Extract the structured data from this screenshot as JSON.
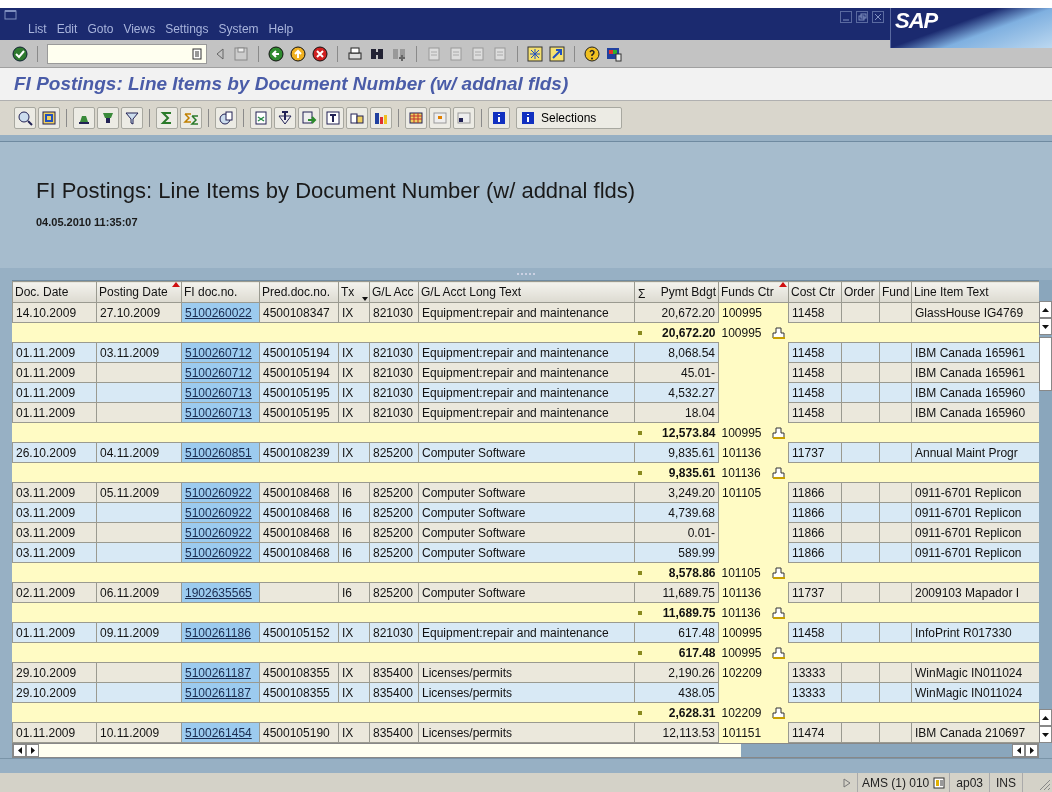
{
  "menu_bar": {
    "items": [
      "List",
      "Edit",
      "Goto",
      "Views",
      "Settings",
      "System",
      "Help"
    ]
  },
  "logo": "SAP",
  "screen_title": "FI Postings: Line Items by Document Number (w/ addnal flds)",
  "app_toolbar": {
    "selections_button": "Selections"
  },
  "report_header": {
    "title": "FI Postings: Line Items by Document Number (w/ addnal flds)",
    "timestamp": "04.05.2010 11:35:07"
  },
  "table": {
    "columns": [
      {
        "label": "Doc. Date",
        "sorted": false,
        "filtered": false
      },
      {
        "label": "Posting Date",
        "sorted": true,
        "filtered": false
      },
      {
        "label": "FI doc.no.",
        "sorted": false,
        "filtered": false
      },
      {
        "label": "Pred.doc.no.",
        "sorted": false,
        "filtered": false
      },
      {
        "label": "Tx",
        "sorted": false,
        "filtered": true
      },
      {
        "label": "G/L Acc",
        "sorted": false,
        "filtered": false
      },
      {
        "label": "G/L Acct Long Text",
        "sorted": false,
        "filtered": false
      },
      {
        "label": "Pymt Bdgt",
        "sum_sign": "Σ",
        "sorted": false,
        "filtered": false
      },
      {
        "label": "Funds Ctr",
        "sorted": true,
        "filtered": false
      },
      {
        "label": "Cost Ctr",
        "sorted": false,
        "filtered": false
      },
      {
        "label": "Order",
        "sorted": false,
        "filtered": false
      },
      {
        "label": "Fund",
        "sorted": false,
        "filtered": false
      },
      {
        "label": "Line Item Text",
        "sorted": false,
        "filtered": false
      }
    ],
    "rows": [
      {
        "kind": "item",
        "doc_date": "14.10.2009",
        "posting_date": "27.10.2009",
        "fi_doc": "5100260022",
        "pred_doc": "4500108347",
        "tx": "IX",
        "gl_acc": "821030",
        "gl_text": "Equipment:repair and maintenance",
        "pymt_bdgt": "20,672.20",
        "funds_ctr": "100995",
        "cost_ctr": "11458",
        "line_item_text": "GlassHouse IG4769"
      },
      {
        "kind": "subtotal",
        "amount": "20,672.20",
        "funds_ctr": "100995"
      },
      {
        "kind": "item",
        "doc_date": "01.11.2009",
        "posting_date": "03.11.2009",
        "fi_doc": "5100260712",
        "pred_doc": "4500105194",
        "tx": "IX",
        "gl_acc": "821030",
        "gl_text": "Equipment:repair and maintenance",
        "pymt_bdgt": "8,068.54",
        "cost_ctr": "11458",
        "line_item_text": "IBM Canada 165961"
      },
      {
        "kind": "item",
        "doc_date": "01.11.2009",
        "fi_doc": "5100260712",
        "pred_doc": "4500105194",
        "tx": "IX",
        "gl_acc": "821030",
        "gl_text": "Equipment:repair and maintenance",
        "pymt_bdgt": "45.01-",
        "cost_ctr": "11458",
        "line_item_text": "IBM Canada 165961"
      },
      {
        "kind": "item",
        "doc_date": "01.11.2009",
        "fi_doc": "5100260713",
        "pred_doc": "4500105195",
        "tx": "IX",
        "gl_acc": "821030",
        "gl_text": "Equipment:repair and maintenance",
        "pymt_bdgt": "4,532.27",
        "cost_ctr": "11458",
        "line_item_text": "IBM Canada 165960"
      },
      {
        "kind": "item",
        "doc_date": "01.11.2009",
        "fi_doc": "5100260713",
        "pred_doc": "4500105195",
        "tx": "IX",
        "gl_acc": "821030",
        "gl_text": "Equipment:repair and maintenance",
        "pymt_bdgt": "18.04",
        "cost_ctr": "11458",
        "line_item_text": "IBM Canada 165960"
      },
      {
        "kind": "subtotal",
        "amount": "12,573.84",
        "funds_ctr": "100995"
      },
      {
        "kind": "item",
        "doc_date": "26.10.2009",
        "posting_date": "04.11.2009",
        "fi_doc": "5100260851",
        "pred_doc": "4500108239",
        "tx": "IX",
        "gl_acc": "825200",
        "gl_text": "Computer Software",
        "pymt_bdgt": "9,835.61",
        "funds_ctr": "101136",
        "cost_ctr": "11737",
        "line_item_text": "Annual Maint Progr"
      },
      {
        "kind": "subtotal",
        "amount": "9,835.61",
        "funds_ctr": "101136"
      },
      {
        "kind": "item",
        "doc_date": "03.11.2009",
        "posting_date": "05.11.2009",
        "fi_doc": "5100260922",
        "pred_doc": "4500108468",
        "tx": "I6",
        "gl_acc": "825200",
        "gl_text": "Computer Software",
        "pymt_bdgt": "3,249.20",
        "funds_ctr": "101105",
        "cost_ctr": "11866",
        "line_item_text": "0911-6701 Replicon"
      },
      {
        "kind": "item",
        "doc_date": "03.11.2009",
        "fi_doc": "5100260922",
        "pred_doc": "4500108468",
        "tx": "I6",
        "gl_acc": "825200",
        "gl_text": "Computer Software",
        "pymt_bdgt": "4,739.68",
        "cost_ctr": "11866",
        "line_item_text": "0911-6701 Replicon"
      },
      {
        "kind": "item",
        "doc_date": "03.11.2009",
        "fi_doc": "5100260922",
        "pred_doc": "4500108468",
        "tx": "I6",
        "gl_acc": "825200",
        "gl_text": "Computer Software",
        "pymt_bdgt": "0.01-",
        "cost_ctr": "11866",
        "line_item_text": "0911-6701 Replicon"
      },
      {
        "kind": "item",
        "doc_date": "03.11.2009",
        "fi_doc": "5100260922",
        "pred_doc": "4500108468",
        "tx": "I6",
        "gl_acc": "825200",
        "gl_text": "Computer Software",
        "pymt_bdgt": "589.99",
        "cost_ctr": "11866",
        "line_item_text": "0911-6701 Replicon"
      },
      {
        "kind": "subtotal",
        "amount": "8,578.86",
        "funds_ctr": "101105"
      },
      {
        "kind": "item",
        "doc_date": "02.11.2009",
        "posting_date": "06.11.2009",
        "fi_doc": "1902635565",
        "tx": "I6",
        "gl_acc": "825200",
        "gl_text": "Computer Software",
        "pymt_bdgt": "11,689.75",
        "funds_ctr": "101136",
        "cost_ctr": "11737",
        "line_item_text": "2009103 Mapador I"
      },
      {
        "kind": "subtotal",
        "amount": "11,689.75",
        "funds_ctr": "101136"
      },
      {
        "kind": "item",
        "doc_date": "01.11.2009",
        "posting_date": "09.11.2009",
        "fi_doc": "5100261186",
        "pred_doc": "4500105152",
        "tx": "IX",
        "gl_acc": "821030",
        "gl_text": "Equipment:repair and maintenance",
        "pymt_bdgt": "617.48",
        "funds_ctr": "100995",
        "cost_ctr": "11458",
        "line_item_text": "InfoPrint R017330"
      },
      {
        "kind": "subtotal",
        "amount": "617.48",
        "funds_ctr": "100995"
      },
      {
        "kind": "item",
        "doc_date": "29.10.2009",
        "fi_doc": "5100261187",
        "pred_doc": "4500108355",
        "tx": "IX",
        "gl_acc": "835400",
        "gl_text": "Licenses/permits",
        "pymt_bdgt": "2,190.26",
        "funds_ctr": "102209",
        "cost_ctr": "13333",
        "line_item_text": "WinMagic IN011024"
      },
      {
        "kind": "item",
        "doc_date": "29.10.2009",
        "fi_doc": "5100261187",
        "pred_doc": "4500108355",
        "tx": "IX",
        "gl_acc": "835400",
        "gl_text": "Licenses/permits",
        "pymt_bdgt": "438.05",
        "cost_ctr": "13333",
        "line_item_text": "WinMagic IN011024"
      },
      {
        "kind": "subtotal",
        "amount": "2,628.31",
        "funds_ctr": "102209"
      },
      {
        "kind": "item",
        "doc_date": "01.11.2009",
        "posting_date": "10.11.2009",
        "fi_doc": "5100261454",
        "pred_doc": "4500105190",
        "tx": "IX",
        "gl_acc": "835400",
        "gl_text": "Licenses/permits",
        "pymt_bdgt": "12,113.53",
        "funds_ctr": "101151",
        "cost_ctr": "11474",
        "line_item_text": "IBM Canada 210697"
      }
    ]
  },
  "status_bar": {
    "system": "AMS (1) 010",
    "server": "ap03",
    "mode": "INS"
  }
}
